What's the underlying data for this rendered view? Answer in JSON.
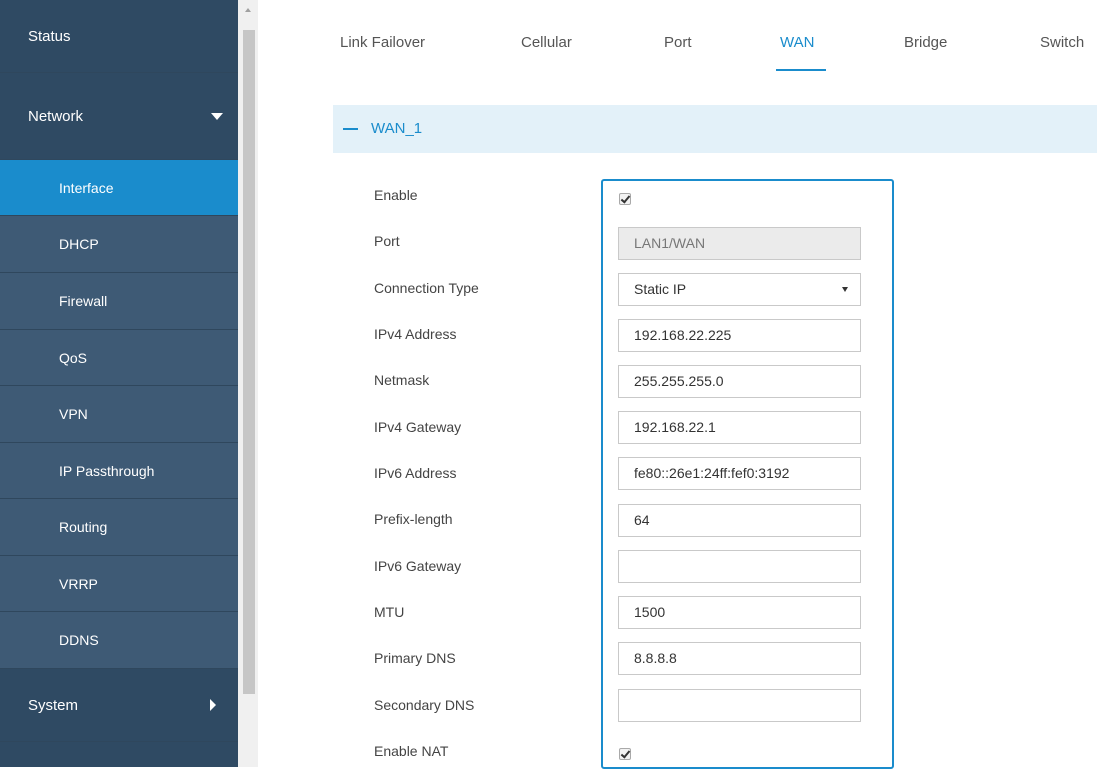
{
  "sidebar": {
    "status": "Status",
    "network": "Network",
    "system": "System",
    "subitems": [
      "Interface",
      "DHCP",
      "Firewall",
      "QoS",
      "VPN",
      "IP Passthrough",
      "Routing",
      "VRRP",
      "DDNS"
    ]
  },
  "tabs": [
    "Link Failover",
    "Cellular",
    "Port",
    "WAN",
    "Bridge",
    "Switch"
  ],
  "active_tab": "WAN",
  "section": {
    "title": "WAN_1"
  },
  "form": {
    "enable_label": "Enable",
    "enable_checked": true,
    "port_label": "Port",
    "port_value": "LAN1/WAN",
    "connection_type_label": "Connection Type",
    "connection_type_value": "Static IP",
    "ipv4_address_label": "IPv4 Address",
    "ipv4_address_value": "192.168.22.225",
    "netmask_label": "Netmask",
    "netmask_value": "255.255.255.0",
    "ipv4_gateway_label": "IPv4 Gateway",
    "ipv4_gateway_value": "192.168.22.1",
    "ipv6_address_label": "IPv6 Address",
    "ipv6_address_value": "fe80::26e1:24ff:fef0:3192",
    "prefix_length_label": "Prefix-length",
    "prefix_length_value": "64",
    "ipv6_gateway_label": "IPv6 Gateway",
    "ipv6_gateway_value": "",
    "mtu_label": "MTU",
    "mtu_value": "1500",
    "primary_dns_label": "Primary DNS",
    "primary_dns_value": "8.8.8.8",
    "secondary_dns_label": "Secondary DNS",
    "secondary_dns_value": "",
    "enable_nat_label": "Enable NAT",
    "enable_nat_checked": true
  },
  "colors": {
    "sidebar_bg": "#3d5872",
    "sidebar_active": "#1a8ccc",
    "accent": "#1a8ccc",
    "section_bg": "#e3f1f9"
  }
}
